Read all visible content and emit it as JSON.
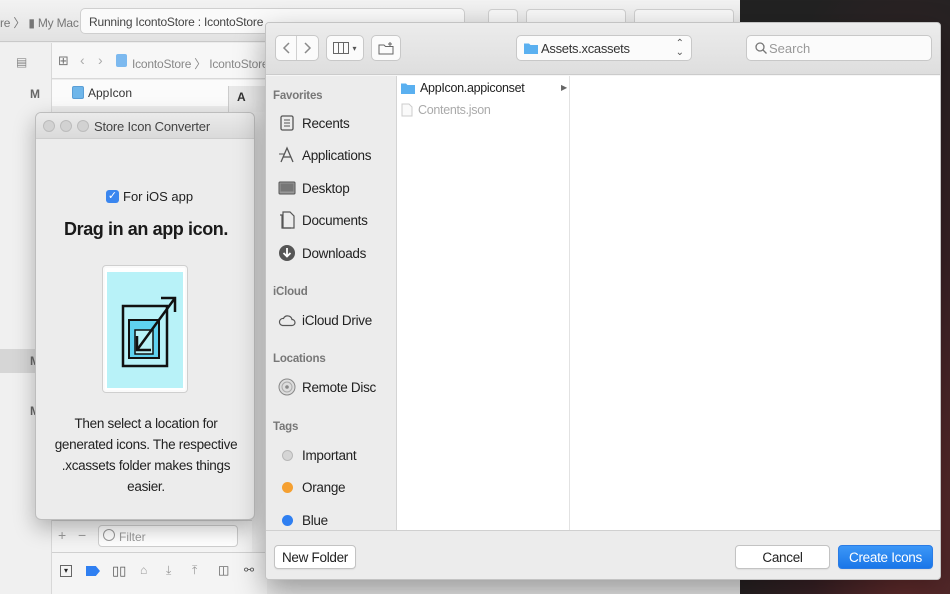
{
  "xcode": {
    "scheme_text": "re 〉 ▮ My Mac",
    "activity_text": "Running IcontoStore : IcontoStore",
    "jump_bar_path": "IcontoStore 〉 IcontoStore",
    "file_name": "AppIcon",
    "file_tab_fragment": "A",
    "nav_letters": [
      "M",
      "M",
      "M"
    ],
    "filter_placeholder": "Filter"
  },
  "converter": {
    "window_title": "Store Icon Converter",
    "ios_checkbox_label": "For iOS app",
    "ios_checked": true,
    "headline": "Drag in an app icon.",
    "instructions": "Then select a location for generated icons. The respective .xcassets folder makes things easier."
  },
  "dialog": {
    "location": "Assets.xcassets",
    "search_placeholder": "Search",
    "sidebar": {
      "favorites_header": "Favorites",
      "favorites": [
        {
          "label": "Recents",
          "icon": "recents-icon"
        },
        {
          "label": "Applications",
          "icon": "applications-icon"
        },
        {
          "label": "Desktop",
          "icon": "desktop-icon"
        },
        {
          "label": "Documents",
          "icon": "documents-icon"
        },
        {
          "label": "Downloads",
          "icon": "downloads-icon"
        }
      ],
      "icloud_header": "iCloud",
      "icloud": [
        {
          "label": "iCloud Drive",
          "icon": "cloud-icon"
        }
      ],
      "locations_header": "Locations",
      "locations": [
        {
          "label": "Remote Disc",
          "icon": "disc-icon"
        }
      ],
      "tags_header": "Tags",
      "tags": [
        {
          "label": "Important",
          "color": "#d5d5d5"
        },
        {
          "label": "Orange",
          "color": "#f5a031"
        },
        {
          "label": "Blue",
          "color": "#2f7ff1"
        }
      ]
    },
    "files": [
      {
        "name": "AppIcon.appiconset",
        "kind": "folder",
        "dimmed": false
      },
      {
        "name": "Contents.json",
        "kind": "file",
        "dimmed": true
      }
    ],
    "new_folder_label": "New Folder",
    "cancel_label": "Cancel",
    "create_label": "Create Icons"
  },
  "colors": {
    "accent": "#1a76e8",
    "folder_blue": "#5ab0f0",
    "icon_cyan": "#b8f2f8"
  }
}
